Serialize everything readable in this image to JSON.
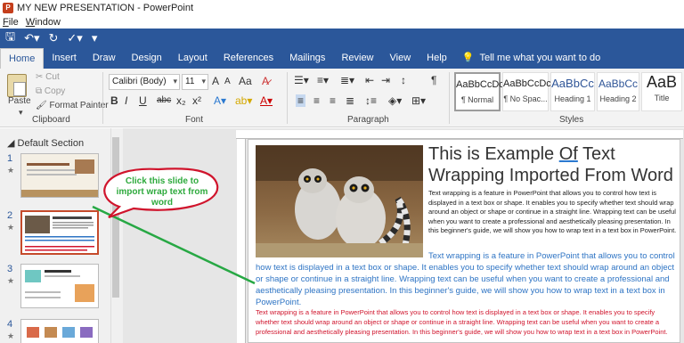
{
  "window": {
    "title": "MY NEW PRESENTATION - PowerPoint",
    "app_icon": "powerpoint-icon"
  },
  "menubar": {
    "items": [
      "File",
      "Window"
    ]
  },
  "tabs": [
    "Home",
    "Insert",
    "Draw",
    "Design",
    "Layout",
    "References",
    "Mailings",
    "Review",
    "View",
    "Help"
  ],
  "active_tab": "Home",
  "tell_me": "Tell me what you want to do",
  "clipboard": {
    "paste": "Paste",
    "cut": "Cut",
    "copy": "Copy",
    "format_painter": "Format Painter",
    "label": "Clipboard"
  },
  "font": {
    "name": "Calibri (Body)",
    "size": "11",
    "label": "Font",
    "bold": "B",
    "italic": "I",
    "underline": "U",
    "strike": "abc",
    "sub": "x₂",
    "sup": "x²",
    "grow": "A",
    "shrink": "A",
    "case": "Aa"
  },
  "paragraph": {
    "label": "Paragraph"
  },
  "styles": {
    "label": "Styles",
    "items": [
      {
        "preview": "AaBbCcDc",
        "name": "¶ Normal"
      },
      {
        "preview": "AaBbCcDc",
        "name": "¶ No Spac..."
      },
      {
        "preview": "AaBbCc",
        "name": "Heading 1"
      },
      {
        "preview": "AaBbCc",
        "name": "Heading 2"
      },
      {
        "preview": "AaB",
        "name": "Title"
      }
    ]
  },
  "slides_panel": {
    "section": "Default Section",
    "slides": [
      {
        "number": "1",
        "star": "★"
      },
      {
        "number": "2",
        "star": "★"
      },
      {
        "number": "3",
        "star": "★"
      },
      {
        "number": "4",
        "star": "★"
      }
    ],
    "selected_slide": "2"
  },
  "callout": {
    "text": "Click this slide to import wrap text from word"
  },
  "slide": {
    "title_part1": "This is Example ",
    "title_of": "Of",
    "title_part2": " Text Wrapping Imported From Word",
    "para1": "Text wrapping is a feature in PowerPoint that allows you to control how text is displayed in a text box or shape. It enables you to specify whether text should wrap around an object or shape or continue in a straight line. Wrapping text can be useful when you want to create a professional and aesthetically pleasing presentation. In this beginner's guide, we will show you how to wrap text in a text box in PowerPoint.",
    "para2_first": "Text wrapping is a feature in PowerPoint that allows you to control",
    "para2_rest": "how text is displayed in a text box or shape. It enables you to specify whether text should wrap around an object or shape or continue in a straight line. Wrapping text can be useful when you want to create a professional and aesthetically pleasing presentation. In this beginner's guide, we will show you how to wrap text in a text box in PowerPoint.",
    "para3": "Text wrapping is a feature in PowerPoint that allows you to control how text is displayed in a text box or shape. It enables you to specify whether text should wrap around an object or shape or continue in a straight line. Wrapping text can be useful when you want to create a professional and aesthetically pleasing presentation. In this beginner's guide, we will show you how to wrap text in a text box in PowerPoint.",
    "photo": "lemurs-photo"
  },
  "colors": {
    "ribbon_blue": "#2b579a",
    "callout_red": "#d0142c",
    "callout_text": "#2eaa3d",
    "arrow_green": "#27a844",
    "link_blue": "#2e74c4",
    "selected_thumb": "#c54a2b"
  }
}
